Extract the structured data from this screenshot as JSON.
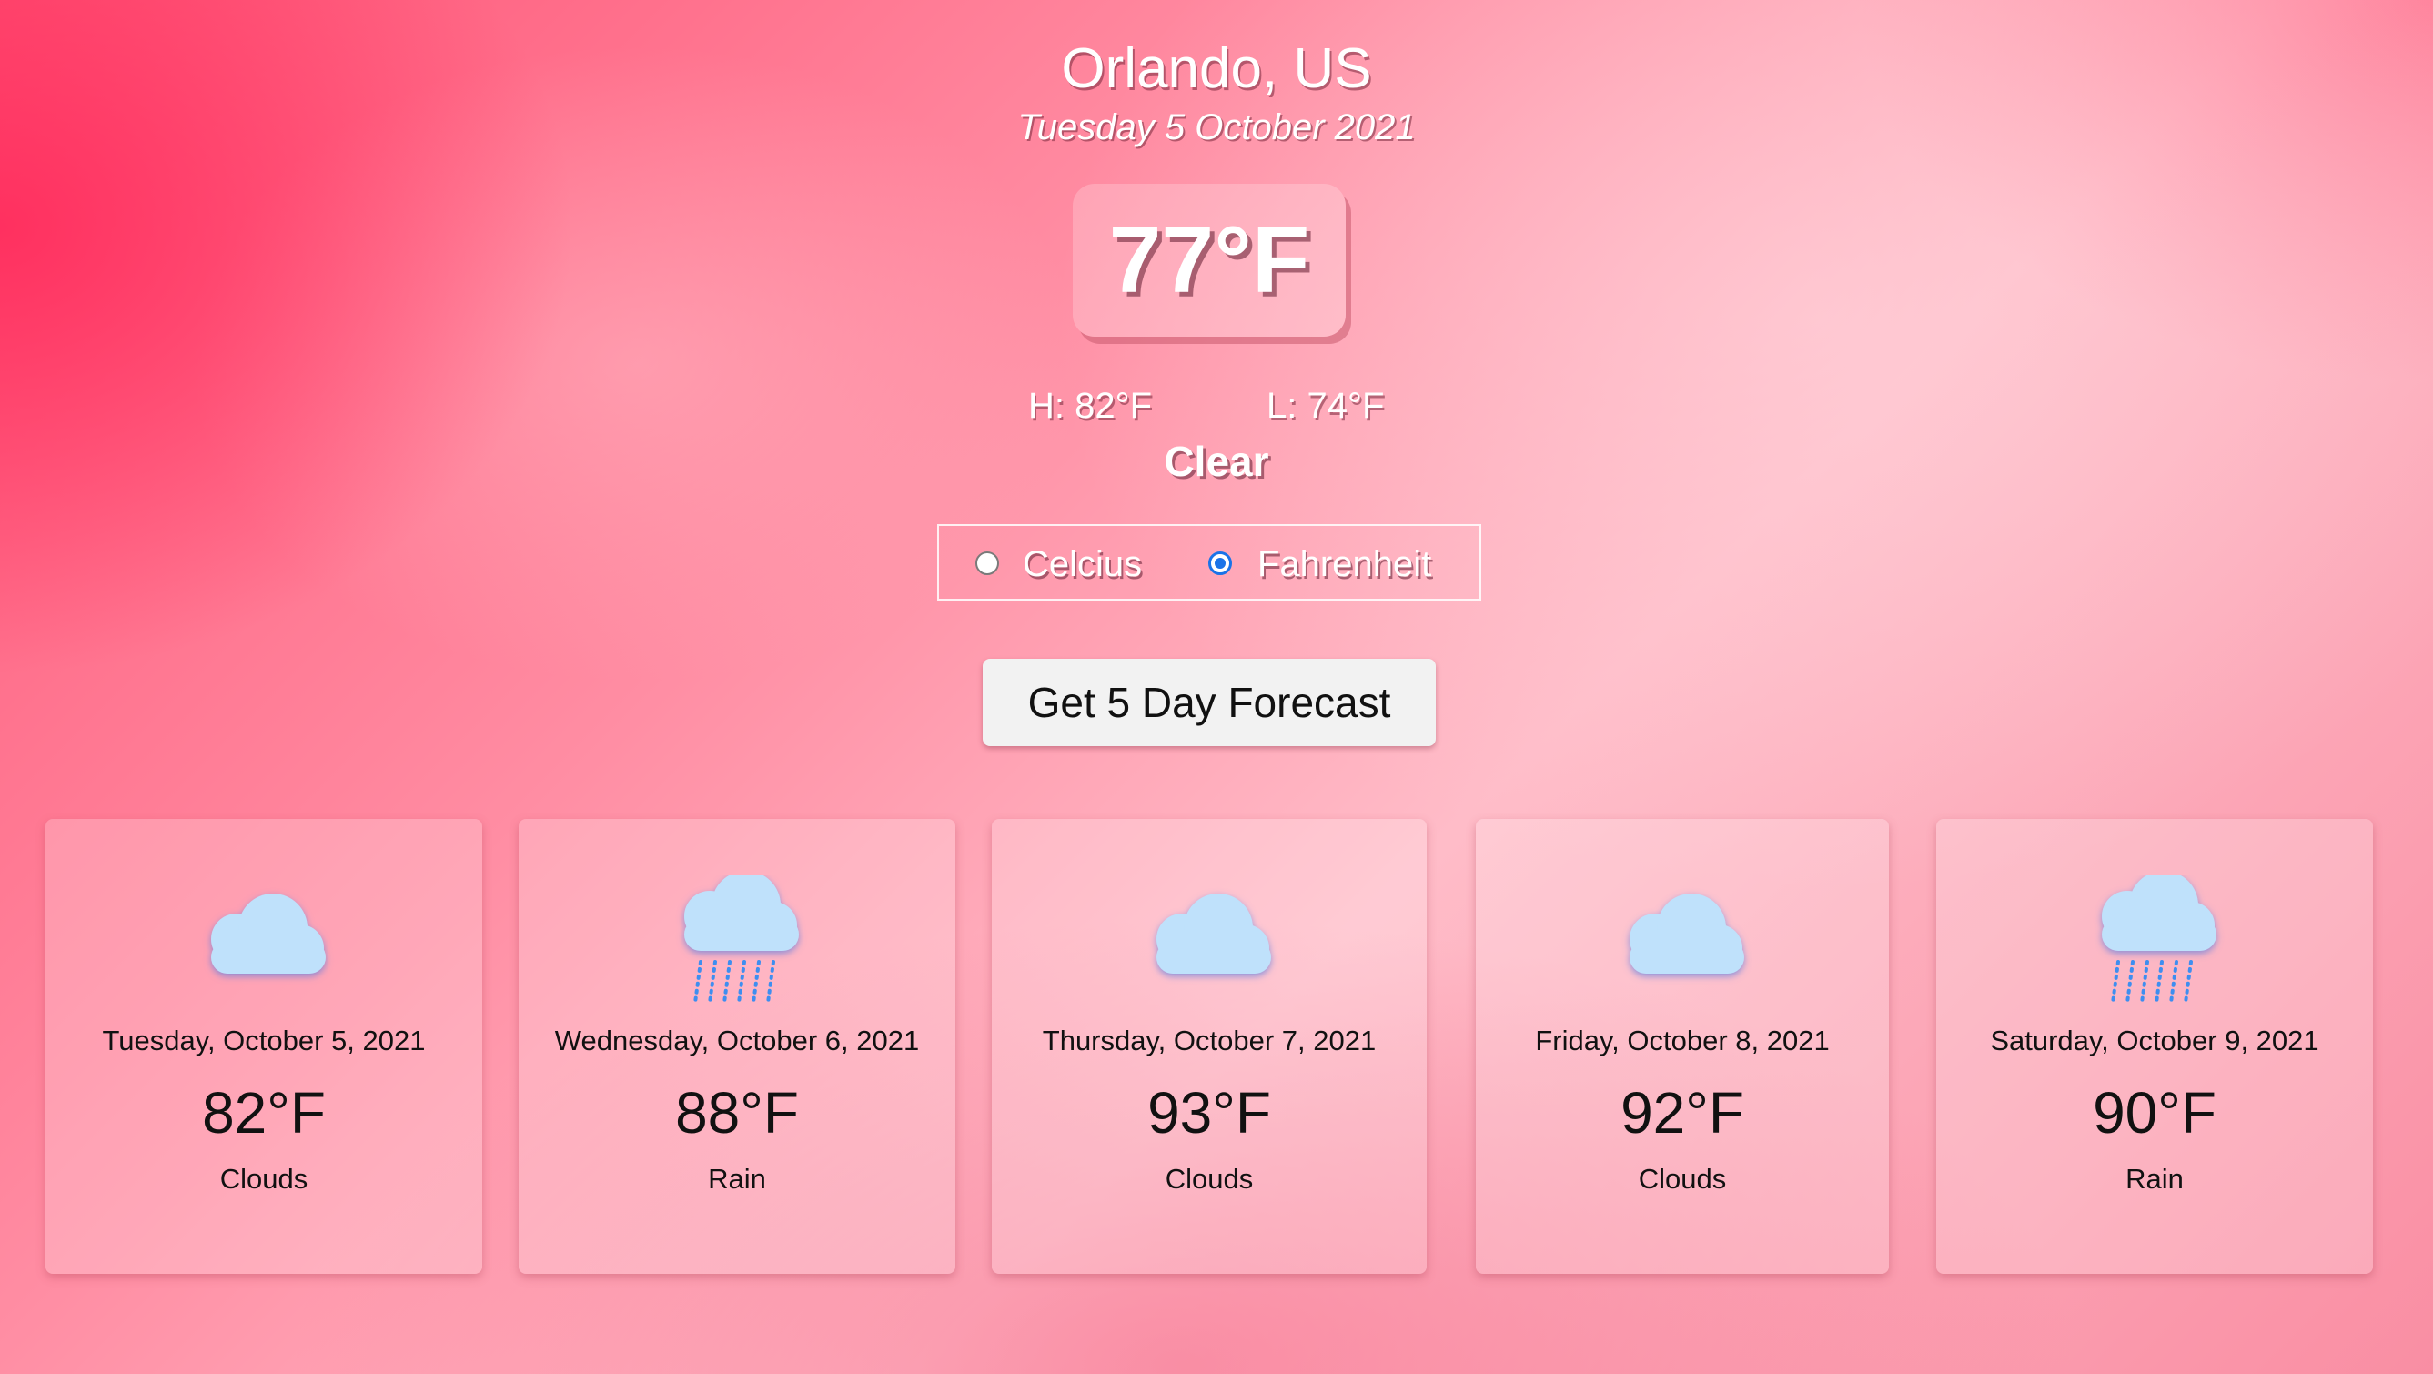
{
  "location": {
    "city": "Orlando, US",
    "date": "Tuesday 5 October 2021"
  },
  "current": {
    "temperature": "77°F",
    "high": "H: 82°F",
    "low": "L: 74°F",
    "condition": "Clear"
  },
  "units": {
    "options": [
      {
        "label": "Celcius",
        "checked": false
      },
      {
        "label": "Fahrenheit",
        "checked": true
      }
    ]
  },
  "forecast_button": {
    "label": "Get 5 Day Forecast"
  },
  "forecast": [
    {
      "date": "Tuesday, October 5, 2021",
      "temp": "82°F",
      "condition": "Clouds",
      "icon": "cloud-icon"
    },
    {
      "date": "Wednesday, October 6, 2021",
      "temp": "88°F",
      "condition": "Rain",
      "icon": "rain-cloud-icon"
    },
    {
      "date": "Thursday, October 7, 2021",
      "temp": "93°F",
      "condition": "Clouds",
      "icon": "cloud-icon"
    },
    {
      "date": "Friday, October 8, 2021",
      "temp": "92°F",
      "condition": "Clouds",
      "icon": "cloud-icon"
    },
    {
      "date": "Saturday, October 9, 2021",
      "temp": "90°F",
      "condition": "Rain",
      "icon": "rain-cloud-icon"
    }
  ]
}
